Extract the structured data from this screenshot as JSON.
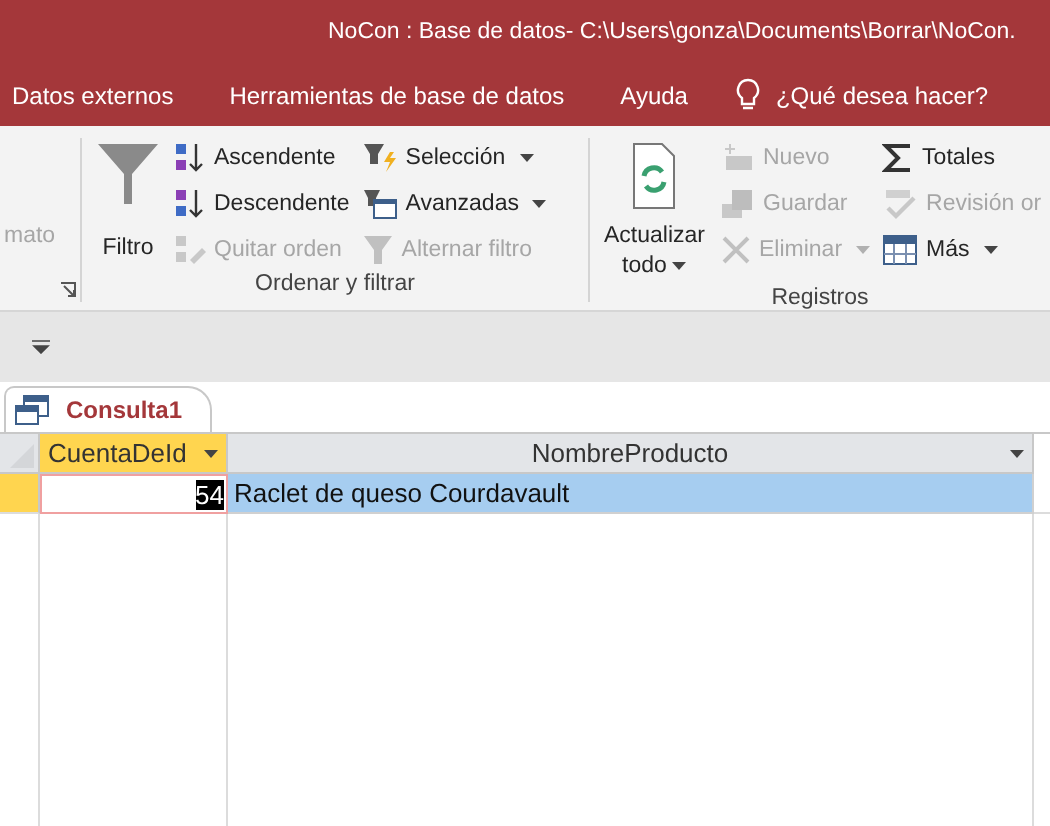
{
  "window": {
    "title": "NoCon : Base de datos- C:\\Users\\gonza\\Documents\\Borrar\\NoCon."
  },
  "menu": {
    "tabs": [
      {
        "label": "Datos externos"
      },
      {
        "label": "Herramientas de base de datos"
      },
      {
        "label": "Ayuda"
      }
    ],
    "tell_me": {
      "placeholder": "¿Qué desea hacer?"
    }
  },
  "ribbon": {
    "groups": [
      {
        "columns": [
          {
            "items": [
              {
                "label": "mato",
                "disabled": true
              }
            ]
          }
        ],
        "dialog_launcher": true
      },
      {
        "label": "Ordenar y filtrar",
        "columns": [
          {
            "kind": "large",
            "items": [
              {
                "label": "Filtro",
                "disabled": false,
                "dropdown": false
              }
            ]
          },
          {
            "kind": "small",
            "items": [
              {
                "label": "Ascendente",
                "disabled": false,
                "dropdown": false
              },
              {
                "label": "Descendente",
                "disabled": false,
                "dropdown": false
              },
              {
                "label": "Quitar orden",
                "disabled": true,
                "dropdown": false
              }
            ]
          },
          {
            "kind": "small",
            "items": [
              {
                "label": "Selección",
                "disabled": false,
                "dropdown": true
              },
              {
                "label": "Avanzadas",
                "disabled": false,
                "dropdown": true
              },
              {
                "label": "Alternar filtro",
                "disabled": true,
                "dropdown": false
              }
            ]
          }
        ]
      },
      {
        "label": "Registros",
        "columns": [
          {
            "kind": "large",
            "items": [
              {
                "label": "Actualizar todo",
                "disabled": false,
                "dropdown": true
              }
            ]
          },
          {
            "kind": "small",
            "items": [
              {
                "label": "Nuevo",
                "disabled": true,
                "dropdown": false
              },
              {
                "label": "Guardar",
                "disabled": true,
                "dropdown": false
              },
              {
                "label": "Eliminar",
                "disabled": true,
                "dropdown": true
              }
            ]
          },
          {
            "kind": "small",
            "items": [
              {
                "label": "Totales",
                "disabled": false,
                "dropdown": false
              },
              {
                "label": "Revisión or",
                "disabled": true,
                "dropdown": false
              },
              {
                "label": "Más",
                "disabled": false,
                "dropdown": true
              }
            ]
          }
        ]
      }
    ]
  },
  "document_tabs": [
    {
      "label": "Consulta1",
      "selected": true
    }
  ],
  "datasheet": {
    "columns": [
      {
        "label": "CuentaDeId",
        "selected": true
      },
      {
        "label": "NombreProducto",
        "selected": false
      }
    ],
    "rows": [
      {
        "selected": true,
        "cells": [
          {
            "value": "54",
            "editing": true
          },
          {
            "value": "Raclet de queso Courdavault",
            "editing": false
          }
        ]
      }
    ]
  }
}
